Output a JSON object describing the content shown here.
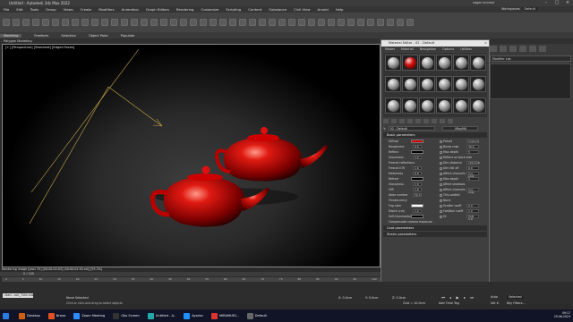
{
  "app": {
    "title": "Untitled - Autodesk 3ds Max 2022",
    "user": "sagar ecomui",
    "workspaces_label": "Workspaces:",
    "workspace": "Default"
  },
  "menu": [
    "File",
    "Edit",
    "Tools",
    "Group",
    "Views",
    "Create",
    "Modifiers",
    "Animation",
    "Graph Editors",
    "Rendering",
    "Customize",
    "Scripting",
    "Content",
    "Substance",
    "Civil View",
    "Arnold",
    "Help"
  ],
  "ribbon": {
    "tabs": [
      "Modeling",
      "Freeform",
      "Selection",
      "Object Paint",
      "Populate"
    ],
    "active": "Modeling",
    "sub": "Polygon Modeling"
  },
  "viewport": {
    "label": "[+] [Perspective] [Standard] [Edged Faces]",
    "status": "Rendering image [pass 35] [00:00:04:03] [00:00:04.90 est] [95.3%]"
  },
  "right_panel": {
    "modifier_list": "Modifier List"
  },
  "material_editor": {
    "title": "Material Editor - 02 - Default",
    "menu": [
      "Modes",
      "Material",
      "Navigation",
      "Options",
      "Utilities"
    ],
    "slots": [
      {
        "material": "grey"
      },
      {
        "material": "red"
      },
      {
        "material": "grey"
      },
      {
        "material": "grey"
      },
      {
        "material": "grey"
      },
      {
        "material": "grey"
      },
      {
        "material": "grey"
      },
      {
        "material": "grey"
      },
      {
        "material": "grey"
      },
      {
        "material": "grey"
      },
      {
        "material": "grey"
      },
      {
        "material": "grey"
      },
      {
        "material": "grey"
      },
      {
        "material": "grey"
      },
      {
        "material": "grey"
      },
      {
        "material": "grey"
      },
      {
        "material": "grey"
      },
      {
        "material": "grey"
      }
    ],
    "name_field": "02 - Default",
    "type_button": "VRayMtl",
    "basic_header": "Basic parameters",
    "rows": [
      {
        "label": "Diffuse",
        "swatch": "#d00000",
        "right": "Preset",
        "right_val": "Custom"
      },
      {
        "label": "Roughness",
        "value": "0.0",
        "right": "Bump map",
        "right_val": "30.0"
      },
      {
        "label": "Reflect",
        "swatch": "#000000",
        "right": "Max depth",
        "right_val": "5"
      },
      {
        "label": "Glossiness",
        "value": "1.0",
        "right": "Reflect on back side"
      },
      {
        "label": "Fresnel reflections",
        "right": "Dim distance",
        "right_val": "100.0cm"
      },
      {
        "label": "Fresnel IOR",
        "value": "1.6",
        "right": "Dim fall off",
        "right_val": "0.0"
      },
      {
        "label": "Metalness",
        "value": "0.0",
        "right": "Affect channels",
        "right_val": "Col.. only"
      },
      {
        "label": "Refract",
        "swatch": "#000000",
        "right": "Max depth",
        "right_val": "5"
      },
      {
        "label": "Glossiness",
        "value": "1.0",
        "right": "Affect shadows"
      },
      {
        "label": "IOR",
        "value": "1.6",
        "right": "Affect channels",
        "right_val": "Col.. only"
      },
      {
        "label": "Abbe number",
        "value": "50.0",
        "right": "Thin-walled"
      },
      {
        "label": "Translucency",
        "right": "None"
      },
      {
        "label": "Fog color",
        "swatch": "#ffffff",
        "right": "Scatter coeff",
        "right_val": "0.0"
      },
      {
        "label": "Depth (cm)",
        "value": "1.0",
        "right": "Fwd/bck coeff",
        "right_val": "1.0"
      },
      {
        "label": "Self-illumination",
        "swatch": "#000000",
        "right": "GI",
        "right_val": "Mult  1.0"
      },
      {
        "label": "Compensate camera exposure"
      }
    ],
    "rollouts": [
      "Coat parameters",
      "Sheen parameters"
    ]
  },
  "timeline": {
    "frame": "0 / 100",
    "ticks": [
      "0",
      "5",
      "10",
      "15",
      "20",
      "25",
      "30",
      "35",
      "40",
      "45",
      "50",
      "55",
      "60",
      "65",
      "70",
      "75",
      "80",
      "85",
      "90",
      "95",
      "100"
    ]
  },
  "status": {
    "maxscript": "Start...ack_7stm.ww",
    "selection": "None Selected",
    "hint": "Click or click-and-drag to select objects",
    "x": "X: 0.0cm",
    "y": "Y: 0.0cm",
    "z": "Z: 0.0cm",
    "grid": "Grid = 10.0cm",
    "add_tag": "Add Time Tag",
    "auto": "Auto",
    "selected": "Selected",
    "set_key": "Set K.",
    "key_filters": "Key Filters..."
  },
  "taskbar": [
    {
      "label": "Desktop",
      "color": "#d06010"
    },
    {
      "label": "Brave",
      "color": "#e05020"
    },
    {
      "label": "Zoom Meeting",
      "color": "#2d8cff"
    },
    {
      "label": "Obs Screen",
      "color": "#333333"
    },
    {
      "label": "Untitled - A..",
      "color": "#2aa"
    },
    {
      "label": "Ayarlar",
      "color": "#1e90ff"
    },
    {
      "label": "MIRAMUR1..",
      "color": "#d33"
    },
    {
      "label": "Default",
      "color": "#666"
    }
  ],
  "tray": {
    "time": "09:17",
    "date": "29.06.2023"
  }
}
